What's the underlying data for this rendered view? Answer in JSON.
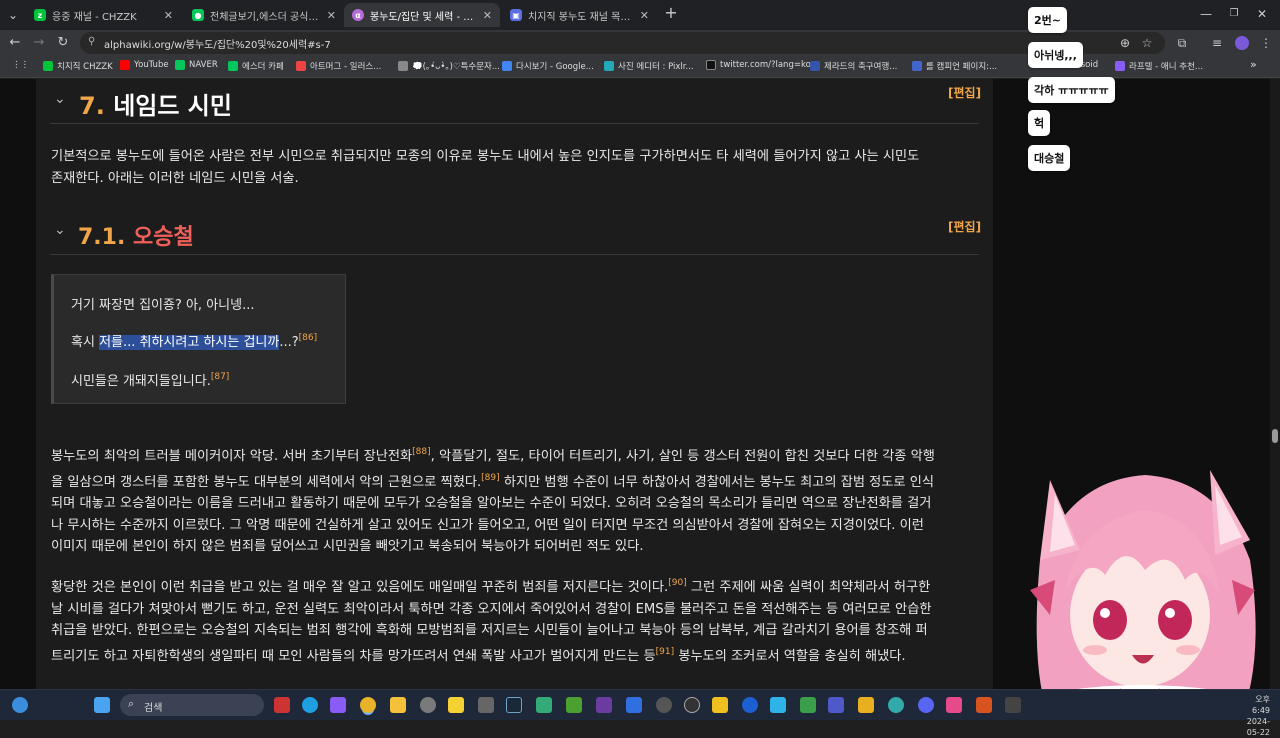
{
  "tabs": [
    {
      "title": "응중 재널 - CHZZK",
      "icon": "chzzk-icon",
      "color": "#00c43b"
    },
    {
      "title": "전체글보기,에스더 공식 팬 카페",
      "icon": "cafe-icon",
      "color": "#03c75a"
    },
    {
      "title": "봉누도/집단 및 세력 - 알파위키",
      "icon": "alphawiki-icon",
      "color": "#b56cd8"
    },
    {
      "title": "치지직 봉누도 재널 목록 | 업데",
      "icon": "list-icon",
      "color": "#5b6ee1"
    }
  ],
  "address": {
    "url": "alphawiki.org/w/봉누도/집단%20및%20세력#s-7"
  },
  "bookmarks": [
    {
      "label": "치지직 CHZZK",
      "color": "#00c43b"
    },
    {
      "label": "YouTube",
      "color": "#ff0000"
    },
    {
      "label": "NAVER",
      "color": "#03c75a"
    },
    {
      "label": "에스더 카페",
      "color": "#03c75a"
    },
    {
      "label": "아트머그 - 일러스...",
      "color": "#e44"
    },
    {
      "label": "💭(｡•́ᴗ•̀｡)♡특수문자...",
      "color": "#888"
    },
    {
      "label": "다시보기 - Google...",
      "color": "#4285f4"
    },
    {
      "label": "사진 에디터 : Pixlr...",
      "color": "#2ab"
    },
    {
      "label": "twitter.com/?lang=ko",
      "color": "#111"
    },
    {
      "label": "제라드의 축구여행...",
      "color": "#35a"
    },
    {
      "label": "롤 캠피언 페이지:...",
      "color": "#46c"
    },
    {
      "label": "ulsoid",
      "color": "#7bd"
    },
    {
      "label": "라프텔 - 애니 추천...",
      "color": "#8a5cf6"
    }
  ],
  "article": {
    "section7": {
      "num": "7.",
      "title": "네임드 시민",
      "edit": "[편집]"
    },
    "intro": [
      "기본적으로 봉누도에 들어온 사람은 전부 시민으로 취급되지만 모종의 이유로 봉누도 내에서 높은 인지도를 구가하면서도 타 세력에 들어가지 않고 사는 시민도",
      "존재한다. 아래는 이러한 네임드 시민을 서술."
    ],
    "section71": {
      "num": "7.1.",
      "title": "오승철",
      "edit": "[편집]"
    },
    "quote": {
      "line1": "거기 짜장면 집이죵? 아, 아니넹...",
      "line2_pre": "혹시 ",
      "line2_sel": "저를... 취하시려고 하시는 겁니까",
      "line2_post": "...?",
      "ref86": "[86]",
      "line3": "시민들은 개돼지들입니다.",
      "ref87": "[87]"
    },
    "p1": [
      {
        "t": "봉누도의 최악의 트러블 메이커이자 악당. 서버 초기부터 장난전화",
        "ref": "[88]",
        "t2": ", 악플달기, 절도, 타이어 터트리기, 사기, 살인 등 갱스터 전원이 합친 것보다 더한 각종 악행"
      },
      {
        "t": "을 일삼으며 갱스터를 포함한 봉누도 대부분의 세력에서 악의 근원으로 찍혔다.",
        "ref": "[89]",
        "t2": " 하지만 범행 수준이 너무 하찮아서 경찰에서는 봉누도 최고의 잡범 정도로 인식"
      },
      {
        "t": "되며 대놓고 오승철이라는 이름을 드러내고 활동하기 때문에 모두가 오승철을 알아보는 수준이 되었다. 오히려 오승철의 목소리가 들리면 역으로 장난전화를 걸거",
        "ref": "",
        "t2": ""
      },
      {
        "t": "나 무시하는 수준까지 이르렀다. 그 악명 때문에 건실하게 살고 있어도 신고가 들어오고, 어떤 일이 터지면 무조건 의심받아서 경찰에 잡혀오는 지경이었다. 이런",
        "ref": "",
        "t2": ""
      },
      {
        "t": "이미지 때문에 본인이 하지 않은 범죄를 덮어쓰고 시민권을 빼앗기고 북송되어 북능아가 되어버린 적도 있다.",
        "ref": "",
        "t2": ""
      }
    ],
    "p2": [
      {
        "t": "황당한 것은 본인이 이런 취급을 받고 있는 걸 매우 잘 알고 있음에도 매일매일 꾸준히 범죄를 저지른다는 것이다.",
        "ref": "[90]",
        "t2": " 그런 주제에 싸움 실력이 최약체라서 허구한"
      },
      {
        "t": "날 시비를 걸다가 쳐맞아서 뻗기도 하고, 운전 실력도 최악이라서 툭하면 각종 오지에서 죽어있어서 경찰이 EMS를 불러주고 돈을 적선해주는 등 여러모로 안습한",
        "ref": "",
        "t2": ""
      },
      {
        "t": "취급을 받았다. 한편으로는 오승철의 지속되는 범죄 행각에 흑화해 모방범죄를 저지르는 시민들이 늘어나고 북능아 등의 남북부, 계급 갈라치기 용어를 창조해 퍼",
        "ref": "",
        "t2": ""
      },
      {
        "t": "트리기도 하고 자퇴한학생의 생일파티 때 모인 사람들의 차를 망가뜨려서 연쇄 폭발 사고가 벌어지게 만드는 등",
        "ref": "[91]",
        "t2": " 봉누도의 조커로서 역할을 충실히 해냈다."
      }
    ]
  },
  "chat": [
    "2번~",
    "아뉘넹,,,",
    "각하 ㅠㅠㅠㅠㅠ",
    "헉",
    "대승철"
  ],
  "taskbar": {
    "search_label": "검색",
    "time": "오후 6:49",
    "date": "2024-05-22"
  },
  "colors": {
    "accent_orange": "#f2a64a",
    "heading_red": "#f0605a",
    "selection": "#2d4f9a"
  }
}
